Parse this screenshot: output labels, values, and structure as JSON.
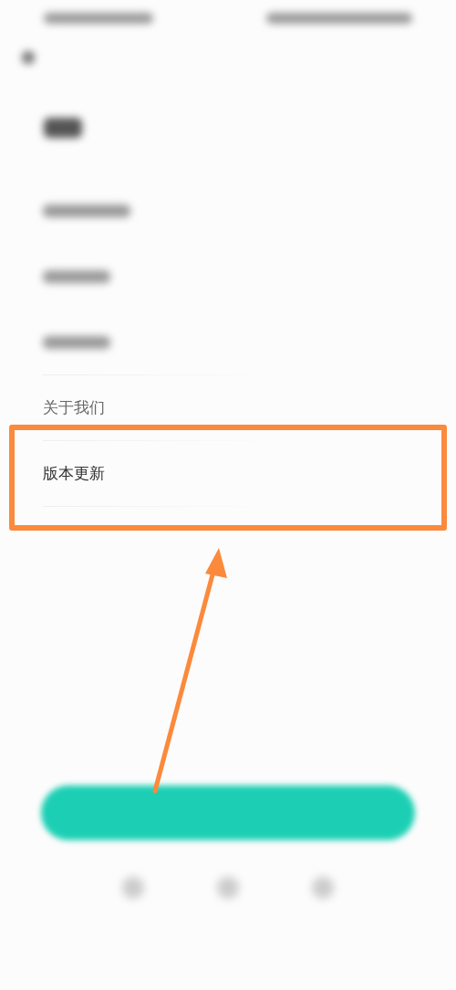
{
  "rows": [
    {
      "kind": "blurred"
    },
    {
      "kind": "blurred"
    },
    {
      "kind": "blurred"
    },
    {
      "kind": "text",
      "label": "关于我们",
      "highlighted": false
    },
    {
      "kind": "text",
      "label": "版本更新",
      "highlighted": true
    }
  ],
  "annotation": {
    "kind": "arrow"
  }
}
